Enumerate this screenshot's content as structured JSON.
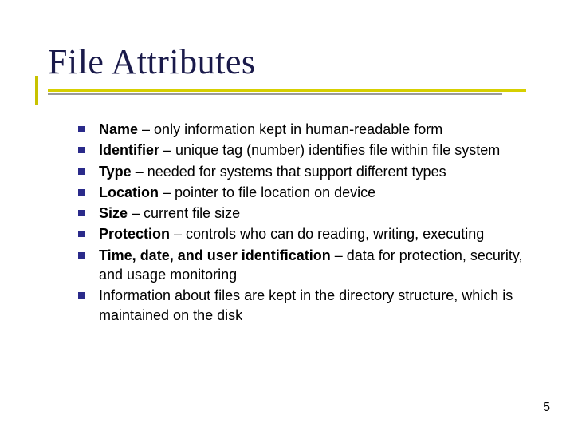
{
  "title": "File Attributes",
  "bullets": [
    {
      "bold": "Name",
      "rest": " – only information kept in human-readable form"
    },
    {
      "bold": "Identifier",
      "rest": " – unique tag (number) identifies file within file system"
    },
    {
      "bold": "Type",
      "rest": " – needed for systems that support different types"
    },
    {
      "bold": "Location",
      "rest": " – pointer to file location on device"
    },
    {
      "bold": "Size",
      "rest": " – current file size"
    },
    {
      "bold": "Protection",
      "rest": " – controls who can do reading, writing, executing"
    },
    {
      "bold": "Time, date, and user identification",
      "rest": " – data for protection, security, and usage monitoring"
    },
    {
      "bold": "",
      "rest": "Information about files are kept in the directory structure, which is maintained on the disk"
    }
  ],
  "page_number": "5"
}
